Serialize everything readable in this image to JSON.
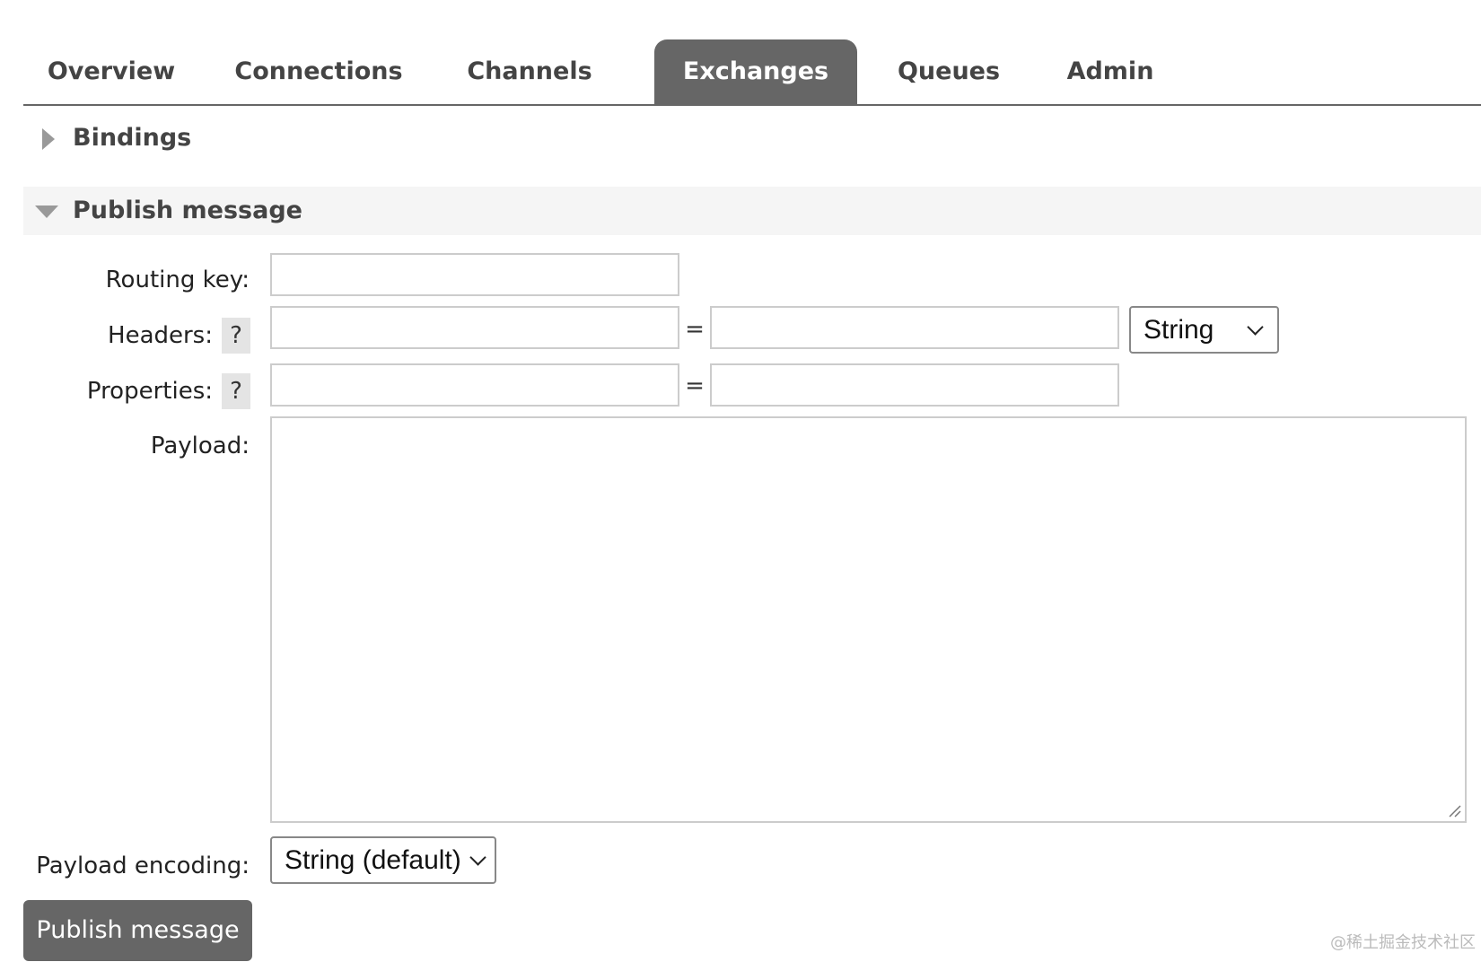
{
  "nav": {
    "tabs": [
      {
        "label": "Overview",
        "active": false
      },
      {
        "label": "Connections",
        "active": false
      },
      {
        "label": "Channels",
        "active": false
      },
      {
        "label": "Exchanges",
        "active": true
      },
      {
        "label": "Queues",
        "active": false
      },
      {
        "label": "Admin",
        "active": false
      }
    ]
  },
  "sections": {
    "bindings": {
      "title": "Bindings",
      "expanded": false
    },
    "publish": {
      "title": "Publish message",
      "expanded": true
    }
  },
  "form": {
    "routing_key": {
      "label": "Routing key:",
      "value": ""
    },
    "headers": {
      "label": "Headers:",
      "help": "?",
      "key": "",
      "separator": "=",
      "value": "",
      "type_selected": "String"
    },
    "properties": {
      "label": "Properties:",
      "help": "?",
      "key": "",
      "separator": "=",
      "value": ""
    },
    "payload": {
      "label": "Payload:",
      "value": ""
    },
    "payload_encoding": {
      "label": "Payload encoding:",
      "selected": "String (default)"
    },
    "submit_label": "Publish message"
  },
  "watermark": "@稀土掘金技术社区",
  "colors": {
    "active_tab_bg": "#666666",
    "button_bg": "#666666",
    "section_header_bg": "#f5f5f5",
    "help_bg": "#e4e4e4"
  }
}
